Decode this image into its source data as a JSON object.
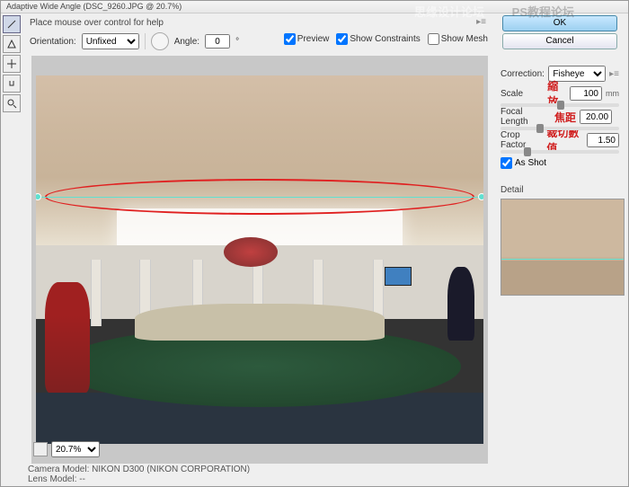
{
  "title": "Adaptive Wide Angle (DSC_9260.JPG @ 20.7%)",
  "help_text": "Place mouse over control for help",
  "orientation": {
    "label": "Orientation:",
    "value": "Unfixed"
  },
  "angle": {
    "label": "Angle:",
    "value": "0",
    "unit": "°"
  },
  "checkboxes": {
    "preview": {
      "label": "Preview",
      "checked": true
    },
    "show_constraints": {
      "label": "Show Constraints",
      "checked": true
    },
    "show_mesh": {
      "label": "Show Mesh",
      "checked": false
    }
  },
  "buttons": {
    "ok": "OK",
    "cancel": "Cancel"
  },
  "correction": {
    "label": "Correction:",
    "value": "Fisheye",
    "scale": {
      "label": "Scale",
      "chinese": "縮放",
      "value": "100",
      "unit": "mm"
    },
    "focal": {
      "label": "Focal Length",
      "chinese": "焦距",
      "value": "20.00"
    },
    "crop": {
      "label": "Crop Factor",
      "chinese": "裁切數值",
      "value": "1.50"
    },
    "as_shot": {
      "label": "As Shot",
      "checked": true
    }
  },
  "detail_label": "Detail",
  "zoom": "20.7%",
  "meta": {
    "camera": "Camera Model: NIKON D300 (NIKON CORPORATION)",
    "lens": "Lens Model: --"
  },
  "watermarks": {
    "w1": "思缘设计论坛",
    "w2": "PS教程论坛"
  },
  "icons": {
    "constraint": "c",
    "poly": "p",
    "move": "m",
    "hand": "h",
    "zoom": "z"
  }
}
